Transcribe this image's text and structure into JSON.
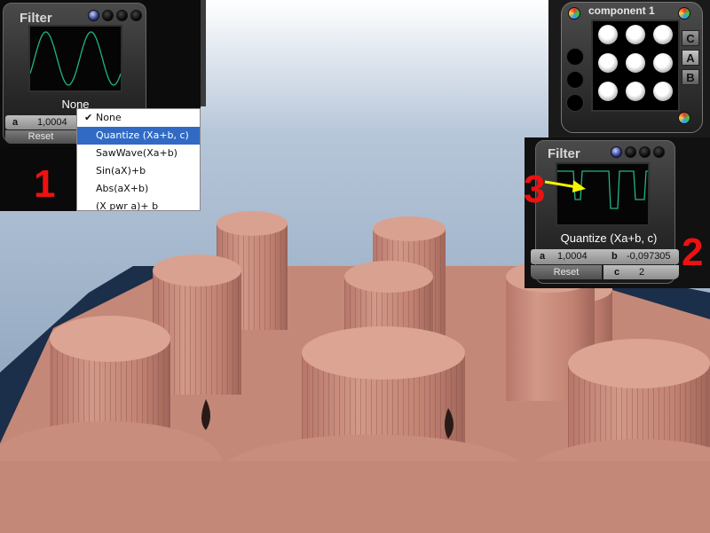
{
  "filter1": {
    "title": "Filter",
    "mode": "None",
    "param_a_label": "a",
    "param_a_value": "1,0004",
    "reset_label": "Reset",
    "annotation": "1"
  },
  "menu": {
    "items": [
      {
        "label": "None",
        "checked": true
      },
      {
        "label": "Quantize (Xa+b, c)",
        "selected": true
      },
      {
        "label": "SawWave(Xa+b)"
      },
      {
        "label": "Sin(aX)+b"
      },
      {
        "label": "Abs(aX+b)"
      },
      {
        "label": "(X pwr a)+ b"
      }
    ],
    "check_glyph": "✔"
  },
  "component": {
    "title": "component 1",
    "buttons": [
      "C",
      "A",
      "B"
    ],
    "active_button": "A"
  },
  "filter2": {
    "title": "Filter",
    "mode": "Quantize (Xa+b, c)",
    "param_a_label": "a",
    "param_a_value": "1,0004",
    "param_b_label": "b",
    "param_b_value": "-0,097305",
    "param_c_label": "c",
    "param_c_value": "2",
    "reset_label": "Reset",
    "annotation": "2"
  },
  "annotation3": "3",
  "colors": {
    "waveform": "#1fb58a",
    "annotation": "#ee1111",
    "arrow": "#f5f500",
    "menu_highlight": "#316ac5",
    "cylinder": "#c8897a",
    "sky_top": "#a9bfd6"
  },
  "icons": {
    "status_dots": "indicator-dot-icon",
    "color_gem": "color-wheel-icon",
    "arrow": "arrow-right-icon"
  }
}
